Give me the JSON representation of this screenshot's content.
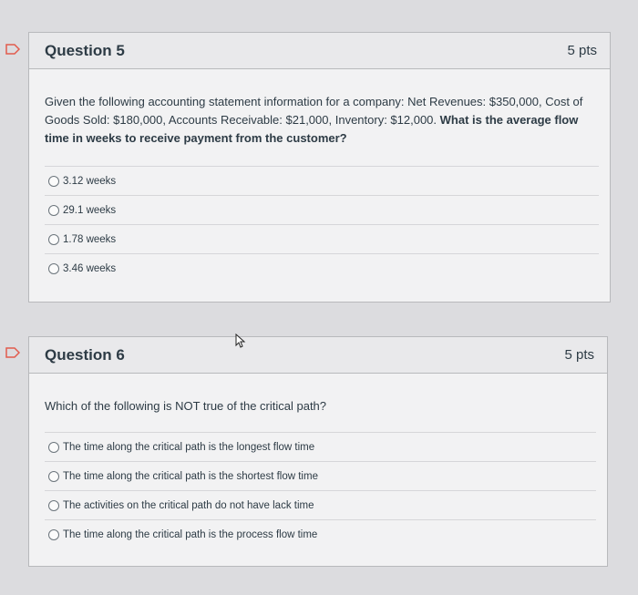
{
  "question5": {
    "title": "Question 5",
    "points": "5 pts",
    "text_plain": "Given the following accounting statement information for a company: Net Revenues: $350,000, Cost of Goods Sold: $180,000, Accounts Receivable: $21,000, Inventory: $12,000.",
    "text_bold": "What is the average flow time in weeks to receive payment from the customer?",
    "answers": [
      {
        "label": "3.12 weeks"
      },
      {
        "label": "29.1 weeks"
      },
      {
        "label": "1.78 weeks"
      },
      {
        "label": "3.46 weeks"
      }
    ]
  },
  "question6": {
    "title": "Question 6",
    "points": "5 pts",
    "text": "Which of the following is NOT true of the critical path?",
    "answers": [
      {
        "label": "The time along the critical path is the longest flow time"
      },
      {
        "label": "The time along the critical path is the shortest flow time"
      },
      {
        "label": "The activities on the critical path do not have lack time"
      },
      {
        "label": "The time along the critical path is the process flow time"
      }
    ]
  },
  "colors": {
    "flag": "#e25b4d",
    "page_background": "#dcdcdf",
    "panel_background": "#f2f2f3",
    "header_background": "#e9e9eb",
    "text": "#2d3b45"
  },
  "icons": {
    "flag": "flag-icon",
    "cursor": "mouse-pointer-icon"
  }
}
